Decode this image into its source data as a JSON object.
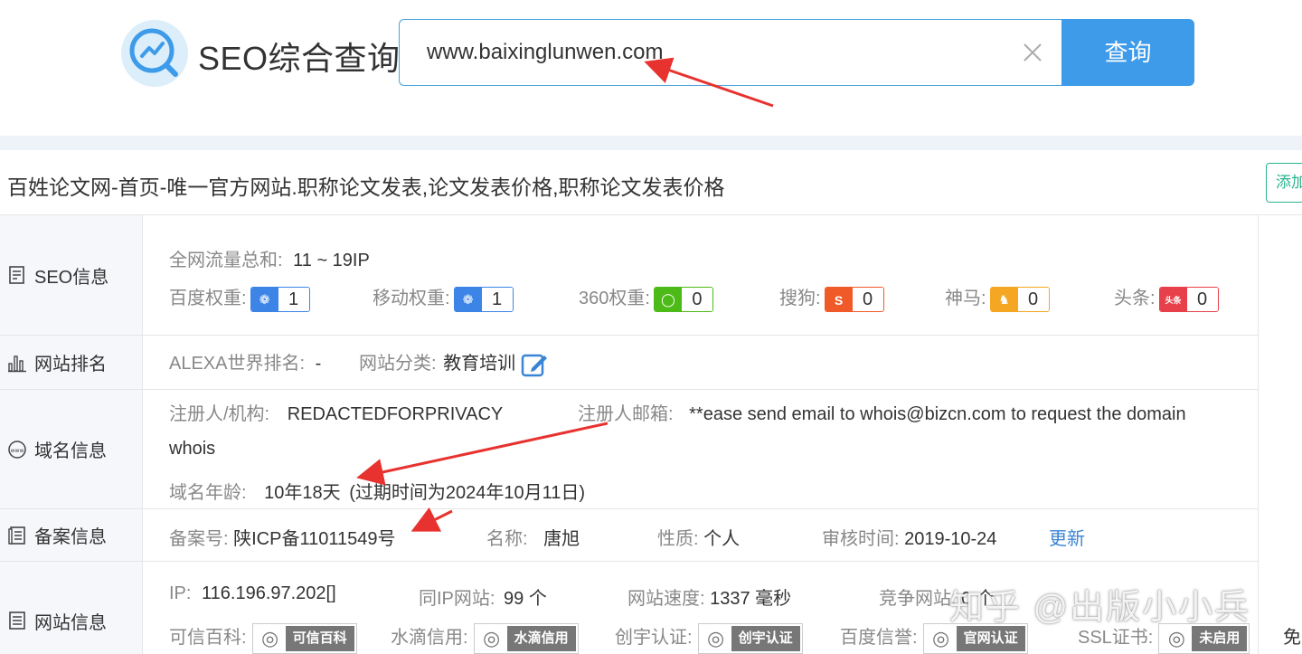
{
  "header": {
    "brand": "SEO综合查询",
    "search_value": "www.baixinglunwen.com",
    "search_button": "查询"
  },
  "site": {
    "title": "百姓论文网-首页-唯一官方网站.职称论文发表,论文发表价格,职称论文发表价格",
    "add_button": "添加"
  },
  "rows": {
    "seo": {
      "label": "SEO信息",
      "traffic_label": "全网流量总和:",
      "traffic_value": "11 ~ 19IP",
      "weights": [
        {
          "label": "百度权重:",
          "value": "1",
          "color": "#3c84e6",
          "icon": "paw"
        },
        {
          "label": "移动权重:",
          "value": "1",
          "color": "#3c84e6",
          "icon": "paw"
        },
        {
          "label": "360权重:",
          "value": "0",
          "color": "#4cbb17",
          "icon": "360"
        },
        {
          "label": "搜狗:",
          "value": "0",
          "color": "#f05a28",
          "icon": "S"
        },
        {
          "label": "神马:",
          "value": "0",
          "color": "#f5a623",
          "icon": "horse"
        },
        {
          "label": "头条:",
          "value": "0",
          "color": "#e8404a",
          "icon": "头条"
        }
      ]
    },
    "rank": {
      "label": "网站排名",
      "alexa_label": "ALEXA世界排名:",
      "alexa_value": "-",
      "category_label": "网站分类:",
      "category_value": "教育培训"
    },
    "domain": {
      "label": "域名信息",
      "registrant_label": "注册人/机构:",
      "registrant_value": "REDACTEDFORPRIVACY",
      "email_label": "注册人邮箱:",
      "email_value": "**ease send email to whois@bizcn.com to request the domain",
      "email_value_2": "whois",
      "age_label": "域名年龄:",
      "age_value": "10年18天",
      "expire_value": "(过期时间为2024年10月11日)"
    },
    "icp": {
      "label": "备案信息",
      "number_label": "备案号:",
      "number_value": "陕ICP备11011549号",
      "name_label": "名称:",
      "name_value": "唐旭",
      "nature_label": "性质:",
      "nature_value": "个人",
      "review_label": "审核时间:",
      "review_value": "2019-10-24",
      "update_link": "更新"
    },
    "web": {
      "label": "网站信息",
      "ip_label": "IP:",
      "ip_value": "116.196.97.202[]",
      "same_ip_label": "同IP网站:",
      "same_ip_value": "99 个",
      "speed_label": "网站速度:",
      "speed_value": "1337 毫秒",
      "compete_label": "竞争网站:",
      "compete_value": "0 个",
      "certs": [
        {
          "label": "可信百科:",
          "tag": "可信百科"
        },
        {
          "label": "水滴信用:",
          "tag": "水滴信用"
        },
        {
          "label": "创宇认证:",
          "tag": "创宇认证"
        },
        {
          "label": "百度信誉:",
          "tag": "官网认证"
        },
        {
          "label": "SSL证书:",
          "tag": "未启用"
        }
      ],
      "trailing": "免"
    }
  },
  "watermark": "知乎 @出版小小兵",
  "colors": {
    "accent": "#3d9be9",
    "link": "#3a84d5",
    "arrow": "#e8322f"
  }
}
